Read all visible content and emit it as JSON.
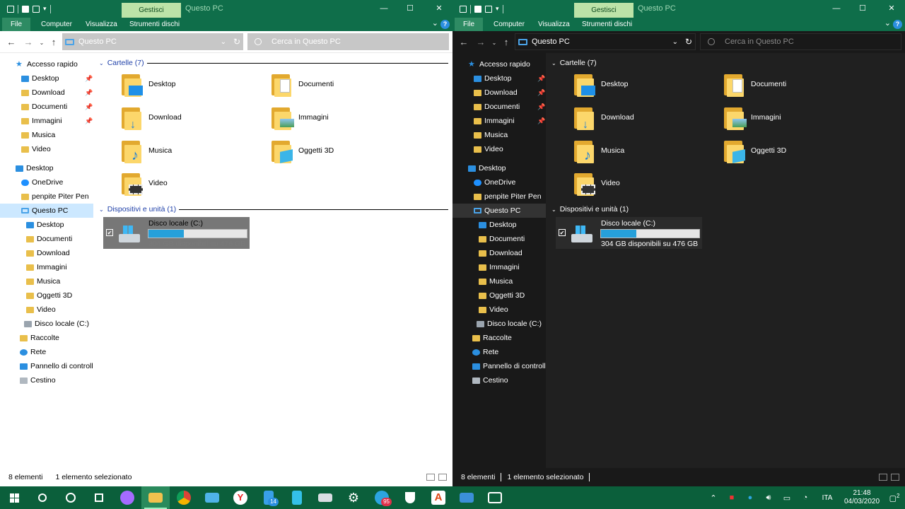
{
  "explorer": {
    "context_tab": "Gestisci",
    "title": "Questo PC",
    "window_controls": {
      "minimize": "—",
      "maximize": "☐",
      "close": "✕"
    },
    "ribbon_tabs": {
      "file": "File",
      "computer": "Computer",
      "view": "Visualizza",
      "drive_tools": "Strumenti dischi"
    },
    "address": "Questo PC",
    "search_placeholder": "Cerca in Questo PC",
    "nav_tree": {
      "quick_access": "Accesso rapido",
      "qa_desktop": "Desktop",
      "qa_download": "Download",
      "qa_documents": "Documenti",
      "qa_images": "Immagini",
      "qa_music": "Musica",
      "qa_video": "Video",
      "desktop": "Desktop",
      "onedrive": "OneDrive",
      "user": "penpite Piter Pen",
      "this_pc": "Questo PC",
      "pc_desktop": "Desktop",
      "pc_documents": "Documenti",
      "pc_download": "Download",
      "pc_images": "Immagini",
      "pc_music": "Musica",
      "pc_3d": "Oggetti 3D",
      "pc_video": "Video",
      "pc_disk": "Disco locale (C:)",
      "libraries": "Raccolte",
      "network": "Rete",
      "control_panel": "Pannello di controllo",
      "recycle_bin": "Cestino"
    },
    "folders_header": "Cartelle (7)",
    "folders": {
      "desktop": "Desktop",
      "documents": "Documenti",
      "download": "Download",
      "images": "Immagini",
      "music": "Musica",
      "objects3d": "Oggetti 3D",
      "video": "Video"
    },
    "devices_header": "Dispositivi e unità (1)",
    "drive": {
      "name": "Disco locale (C:)",
      "info": "304 GB disponibili su 476 GB",
      "used_fraction": 0.36
    },
    "status": {
      "items": "8 elementi",
      "selected": "1 elemento selezionato"
    }
  },
  "taskbar": {
    "badges": {
      "mail": "14",
      "telegram": "95"
    },
    "tray": {
      "lang": "ITA",
      "time": "21:48",
      "date": "04/03/2020",
      "notifications": "2"
    }
  },
  "colors": {
    "titlebar": "#0f6e4a",
    "context_tab": "#bce3a8",
    "taskbar": "#0b5f3b",
    "accent": "#26a0da"
  }
}
